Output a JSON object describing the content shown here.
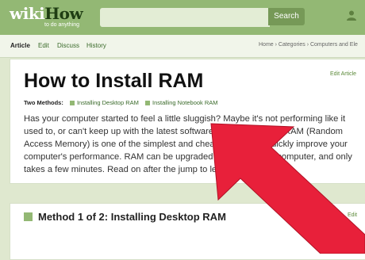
{
  "header": {
    "logo_wiki": "wiki",
    "logo_how": "How",
    "tagline": "to do anything",
    "search_placeholder": "",
    "search_button": "Search"
  },
  "tabs": {
    "article": "Article",
    "edit": "Edit",
    "discuss": "Discuss",
    "history": "History"
  },
  "breadcrumb": "Home › Categories › Computers and Ele",
  "article": {
    "edit_link": "Edit Article",
    "title": "How to Install RAM",
    "methods_label": "Two Methods:",
    "methods": [
      "Installing Desktop RAM",
      "Installing Notebook RAM"
    ],
    "intro": "Has your computer started to feel a little sluggish? Maybe it's not performing like it used to, or can't keep up with the latest software? Upgrading your RAM (Random Access Memory) is one of the simplest and cheapest ways to quickly improve your computer's performance. RAM can be upgraded on virtually any computer, and only takes a few minutes. Read on after the jump to learn how."
  },
  "section": {
    "title": "Method 1 of 2: Installing Desktop RAM",
    "edit_link": "Edit"
  },
  "colors": {
    "brand_green": "#93b874",
    "link_green": "#3a6a2a",
    "arrow_red": "#e8203a"
  }
}
